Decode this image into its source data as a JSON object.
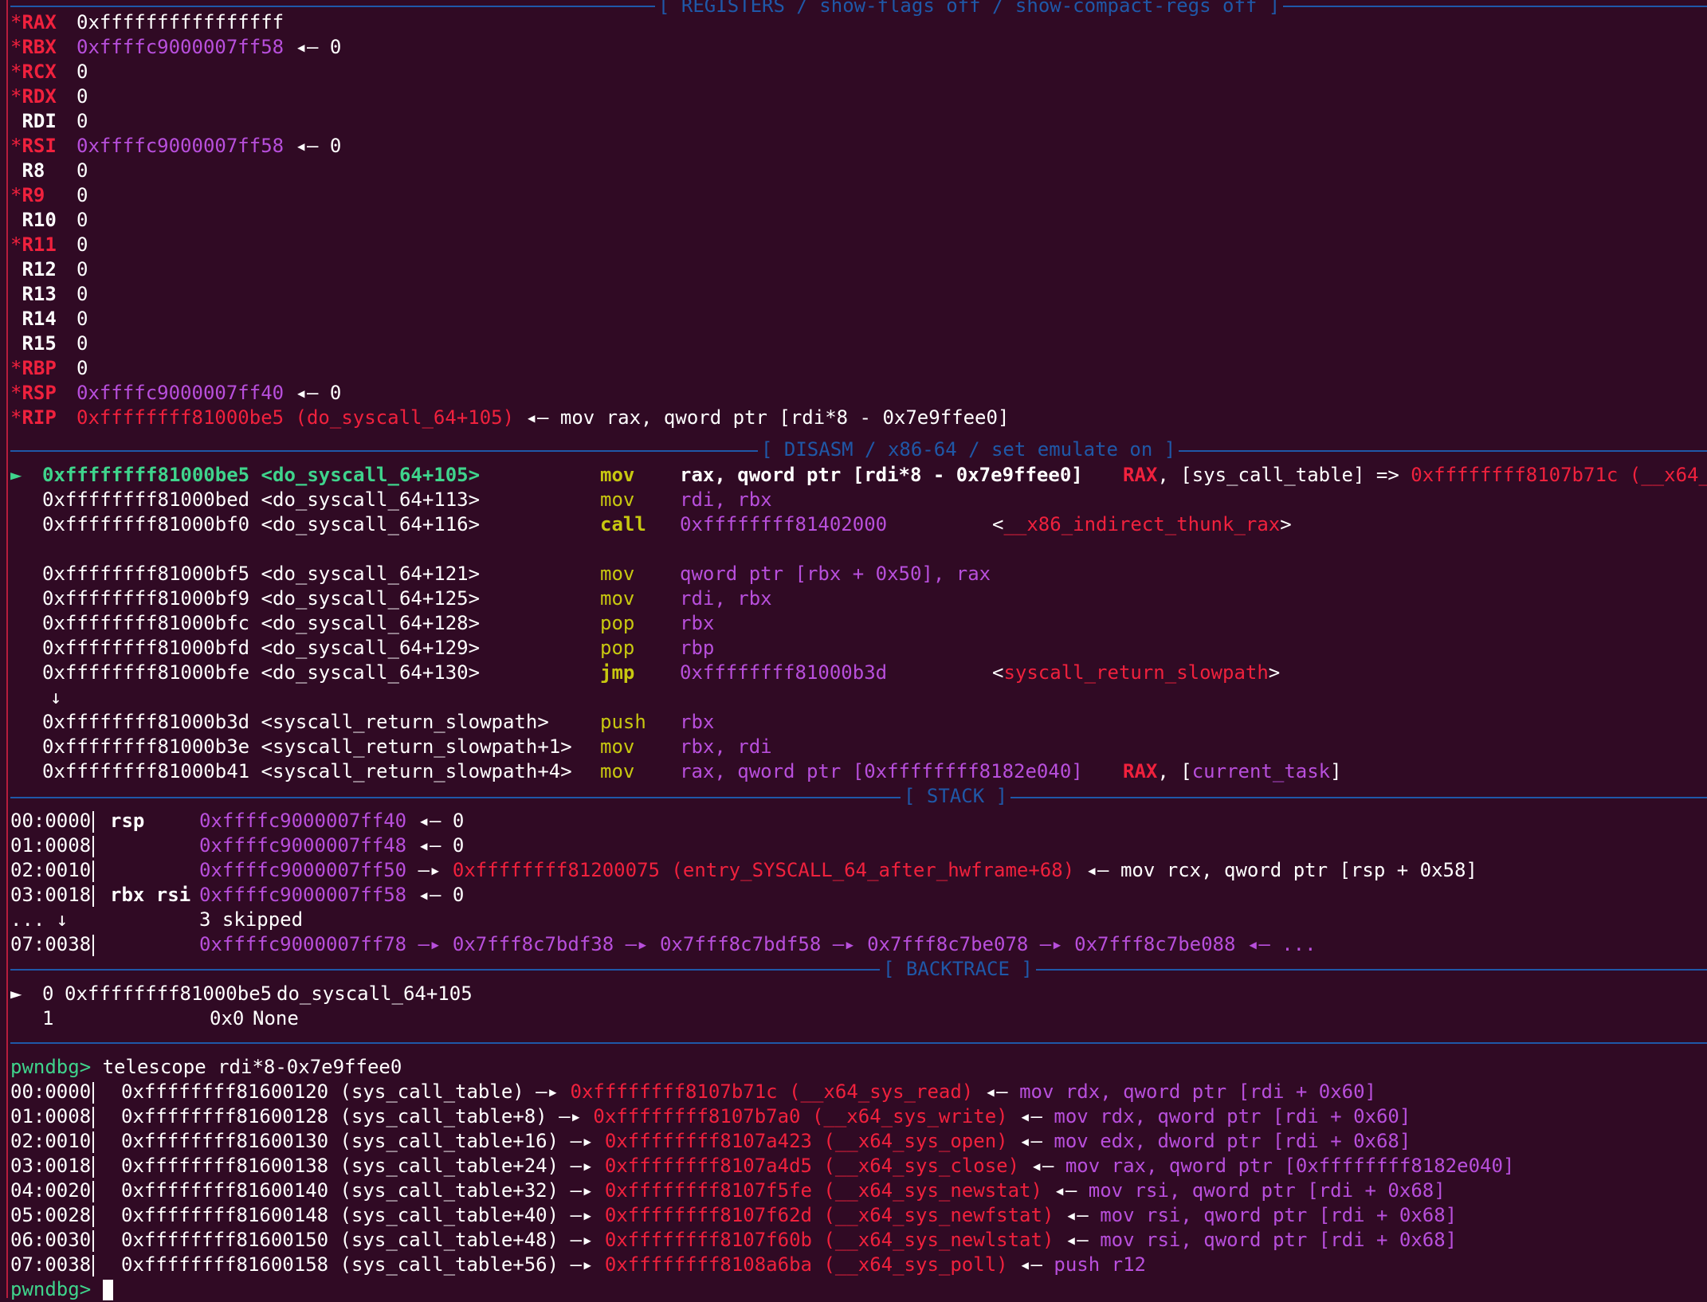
{
  "headers": {
    "registers": "[ REGISTERS / show-flags off / show-compact-regs off ]",
    "disasm": "[ DISASM / x86-64 / set emulate on ]",
    "stack": "[ STACK ]",
    "backtrace": "[ BACKTRACE ]"
  },
  "registers": [
    {
      "mark": "*",
      "name": "RAX",
      "value": "0xffffffffffffffff",
      "suffix": ""
    },
    {
      "mark": "*",
      "name": "RBX",
      "value": "0xffffc9000007ff58",
      "suffix": " ◂— 0"
    },
    {
      "mark": "*",
      "name": "RCX",
      "value": "0",
      "suffix": ""
    },
    {
      "mark": "*",
      "name": "RDX",
      "value": "0",
      "suffix": ""
    },
    {
      "mark": " ",
      "name": "RDI",
      "value": "0",
      "suffix": ""
    },
    {
      "mark": "*",
      "name": "RSI",
      "value": "0xffffc9000007ff58",
      "suffix": " ◂— 0"
    },
    {
      "mark": " ",
      "name": "R8",
      "value": "0",
      "suffix": ""
    },
    {
      "mark": "*",
      "name": "R9",
      "value": "0",
      "suffix": ""
    },
    {
      "mark": " ",
      "name": "R10",
      "value": "0",
      "suffix": ""
    },
    {
      "mark": "*",
      "name": "R11",
      "value": "0",
      "suffix": ""
    },
    {
      "mark": " ",
      "name": "R12",
      "value": "0",
      "suffix": ""
    },
    {
      "mark": " ",
      "name": "R13",
      "value": "0",
      "suffix": ""
    },
    {
      "mark": " ",
      "name": "R14",
      "value": "0",
      "suffix": ""
    },
    {
      "mark": " ",
      "name": "R15",
      "value": "0",
      "suffix": ""
    },
    {
      "mark": "*",
      "name": "RBP",
      "value": "0",
      "suffix": ""
    },
    {
      "mark": "*",
      "name": "RSP",
      "value": "0xffffc9000007ff40",
      "suffix": " ◂— 0"
    },
    {
      "mark": "*",
      "name": "RIP",
      "value": "0xffffffff81000be5 (do_syscall_64+105)",
      "suffix": " ◂— mov rax, qword ptr [rdi*8 - 0x7e9ffee0]"
    }
  ],
  "disasm": [
    {
      "cur": "►",
      "addr": "0xffffffff81000be5",
      "sym": "<do_syscall_64+105>",
      "mn": "mov",
      "ops": "rax, qword ptr [rdi*8 - 0x7e9ffee0]",
      "note_a": "RAX",
      "note_b": ", [sys_call_table] => ",
      "note_c": "0xffffffff8107b71c (__x64_s"
    },
    {
      "addr": "0xffffffff81000bed",
      "sym": "<do_syscall_64+113>",
      "mn": "mov",
      "ops": "rdi, rbx"
    },
    {
      "addr": "0xffffffff81000bf0",
      "sym": "<do_syscall_64+116>",
      "mn": "call",
      "ops": "0xffffffff81402000",
      "target": "__x86_indirect_thunk_rax"
    },
    {
      "addr": "0xffffffff81000bf5",
      "sym": "<do_syscall_64+121>",
      "mn": "mov",
      "ops": "qword ptr [rbx + 0x50], rax"
    },
    {
      "addr": "0xffffffff81000bf9",
      "sym": "<do_syscall_64+125>",
      "mn": "mov",
      "ops": "rdi, rbx"
    },
    {
      "addr": "0xffffffff81000bfc",
      "sym": "<do_syscall_64+128>",
      "mn": "pop",
      "ops": "rbx"
    },
    {
      "addr": "0xffffffff81000bfd",
      "sym": "<do_syscall_64+129>",
      "mn": "pop",
      "ops": "rbp"
    },
    {
      "addr": "0xffffffff81000bfe",
      "sym": "<do_syscall_64+130>",
      "mn": "jmp",
      "ops": "0xffffffff81000b3d",
      "target": "syscall_return_slowpath"
    },
    {
      "arrow": "↓"
    },
    {
      "addr": "0xffffffff81000b3d",
      "sym": "<syscall_return_slowpath>",
      "mn": "push",
      "ops": "rbx"
    },
    {
      "addr": "0xffffffff81000b3e",
      "sym": "<syscall_return_slowpath+1>",
      "mn": "mov",
      "ops": "rbx, rdi"
    },
    {
      "addr": "0xffffffff81000b41",
      "sym": "<syscall_return_slowpath+4>",
      "mn": "mov",
      "ops": "rax, qword ptr [0xffffffff8182e040]",
      "note_a": "RAX",
      "note_b": ", [",
      "note_c": "current_task",
      "note_d": "]"
    }
  ],
  "stack": [
    {
      "off": "00:0000",
      "reg": "rsp",
      "addr": "0xffffc9000007ff40",
      "rest": " ◂— 0"
    },
    {
      "off": "01:0008",
      "reg": "",
      "addr": "0xffffc9000007ff48",
      "rest": " ◂— 0"
    },
    {
      "off": "02:0010",
      "reg": "",
      "addr": "0xffffc9000007ff50",
      "arrow": " —▸ ",
      "target": "0xffffffff81200075 (entry_SYSCALL_64_after_hwframe+68)",
      "rest": " ◂— mov rcx, qword ptr [rsp + 0x58]"
    },
    {
      "off": "03:0018",
      "reg": "rbx rsi",
      "addr": "0xffffc9000007ff58",
      "rest": " ◂— 0"
    },
    {
      "off": "... ↓",
      "skip": "3 skipped"
    },
    {
      "off": "07:0038",
      "reg": "",
      "addr": "0xffffc9000007ff78",
      "chain": " —▸ 0x7fff8c7bdf38 —▸ 0x7fff8c7bdf58 —▸ 0x7fff8c7be078 —▸ 0x7fff8c7be088 ◂— ..."
    }
  ],
  "backtrace": [
    {
      "mark": "►",
      "idx": "0",
      "addr": "0xffffffff81000be5",
      "sym": "do_syscall_64+105"
    },
    {
      "mark": " ",
      "idx": "1",
      "addr": "0x0",
      "sym": "None"
    }
  ],
  "prompt": "pwndbg>",
  "command": "telescope rdi*8-0x7e9ffee0",
  "telescope": [
    {
      "off": "00:0000",
      "addr": "0xffffffff81600120 (sys_call_table)",
      "target": "0xffffffff8107b71c (__x64_sys_read)",
      "ins": "mov rdx, qword ptr [rdi + 0x60]"
    },
    {
      "off": "01:0008",
      "addr": "0xffffffff81600128 (sys_call_table+8)",
      "target": "0xffffffff8107b7a0 (__x64_sys_write)",
      "ins": "mov rdx, qword ptr [rdi + 0x60]"
    },
    {
      "off": "02:0010",
      "addr": "0xffffffff81600130 (sys_call_table+16)",
      "target": "0xffffffff8107a423 (__x64_sys_open)",
      "ins": "mov edx, dword ptr [rdi + 0x68]"
    },
    {
      "off": "03:0018",
      "addr": "0xffffffff81600138 (sys_call_table+24)",
      "target": "0xffffffff8107a4d5 (__x64_sys_close)",
      "ins": "mov rax, qword ptr [0xffffffff8182e040]"
    },
    {
      "off": "04:0020",
      "addr": "0xffffffff81600140 (sys_call_table+32)",
      "target": "0xffffffff8107f5fe (__x64_sys_newstat)",
      "ins": "mov rsi, qword ptr [rdi + 0x68]"
    },
    {
      "off": "05:0028",
      "addr": "0xffffffff81600148 (sys_call_table+40)",
      "target": "0xffffffff8107f62d (__x64_sys_newfstat)",
      "ins": "mov rsi, qword ptr [rdi + 0x68]"
    },
    {
      "off": "06:0030",
      "addr": "0xffffffff81600150 (sys_call_table+48)",
      "target": "0xffffffff8107f60b (__x64_sys_newlstat)",
      "ins": "mov rsi, qword ptr [rdi + 0x68]"
    },
    {
      "off": "07:0038",
      "addr": "0xffffffff81600158 (sys_call_table+56)",
      "target": "0xffffffff8108a6ba (__x64_sys_poll)",
      "ins": "push r12"
    }
  ],
  "colors": {
    "background": "#300a24",
    "red": "#f0213d",
    "purple": "#b84fdc",
    "yellow": "#c8c810",
    "green": "#3fd48c",
    "blue": "#1f58a8"
  }
}
